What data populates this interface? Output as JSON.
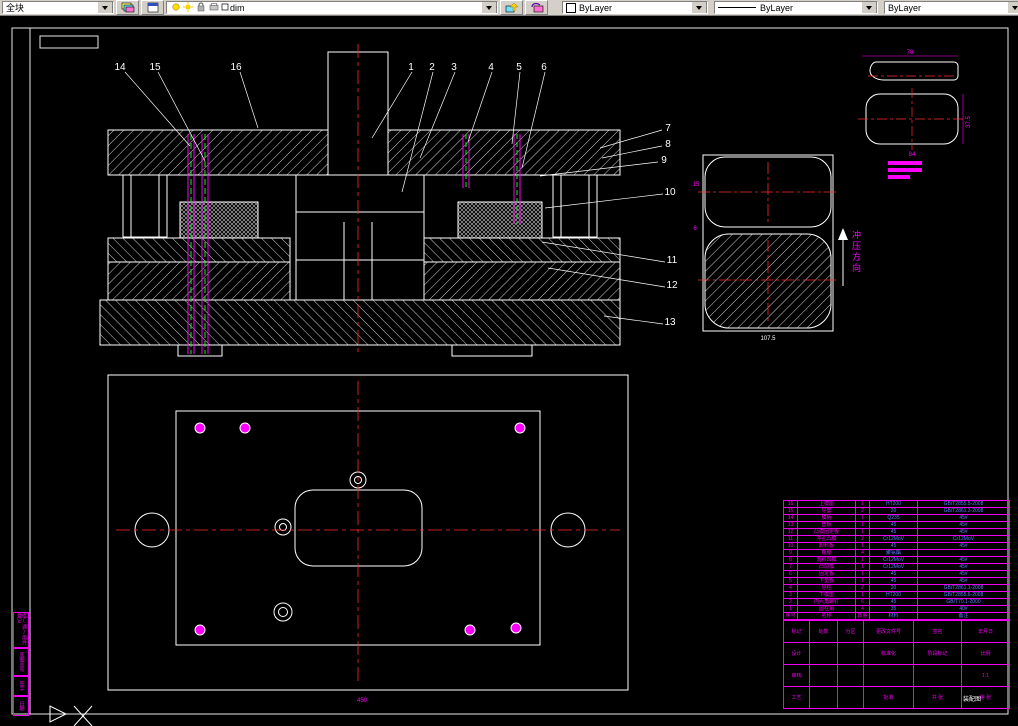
{
  "toolbar": {
    "style_combo": "全块",
    "layer_combo": "dim",
    "color_combo": "ByLayer",
    "linetype_combo": "ByLayer",
    "lineweight_combo": "ByLayer"
  },
  "callouts": [
    "1",
    "2",
    "3",
    "4",
    "5",
    "6",
    "7",
    "8",
    "9",
    "10",
    "11",
    "12",
    "13",
    "14",
    "15",
    "16"
  ],
  "labels": {
    "stamp_direction": "冲压方向",
    "detail_dim": "107.5",
    "detail_dim_a": "15",
    "detail_dim_b": "6",
    "strip_dim": "78",
    "part_dim_h": "37.5",
    "part_dim_w": "84",
    "plan_dim": "450"
  },
  "frame": {
    "left_labels": [
      "借(通)用件登记",
      "底图总号",
      "签字",
      "日期"
    ]
  },
  "title_block": {
    "bom_header": [
      "序号",
      "名称",
      "数量",
      "材料",
      "备注"
    ],
    "bom": [
      [
        "16",
        "上模座",
        "1",
        "HT200",
        "GB/T2855.5-2008"
      ],
      [
        "15",
        "导套",
        "2",
        "20",
        "GB/T2861.3-2008"
      ],
      [
        "14",
        "模柄",
        "1",
        "Q235",
        "45#"
      ],
      [
        "13",
        "垫板",
        "1",
        "45",
        "45#"
      ],
      [
        "12",
        "凸模固定板",
        "1",
        "45",
        "45#"
      ],
      [
        "11",
        "冲孔凸模",
        "2",
        "Cr12MoV",
        "Cr12MoV"
      ],
      [
        "10",
        "卸料板",
        "1",
        "45",
        "45#"
      ],
      [
        "9",
        "橡胶",
        "4",
        "聚氨酯",
        ""
      ],
      [
        "8",
        "落料凹模",
        "1",
        "Cr12MoV",
        "45#"
      ],
      [
        "7",
        "凸凹模",
        "1",
        "Cr12MoV",
        "45#"
      ],
      [
        "6",
        "固定板",
        "1",
        "45",
        "45#"
      ],
      [
        "5",
        "下垫板",
        "1",
        "45",
        "45#"
      ],
      [
        "4",
        "导柱",
        "2",
        "20",
        "GB/T2861.1-2008"
      ],
      [
        "3",
        "下模座",
        "1",
        "HT200",
        "GB/T2855.6-2008"
      ],
      [
        "2",
        "内六角螺钉",
        "6",
        "45",
        "GB/T70.1-2000"
      ],
      [
        "1",
        "圆柱销",
        "4",
        "35",
        "40#"
      ]
    ],
    "fields_rows": [
      [
        "标记",
        "处数",
        "分区",
        "更改文件号",
        "签名",
        "年月日"
      ],
      [
        "设计",
        "",
        "",
        "标准化",
        "阶段标记",
        "比例"
      ],
      [
        "审核",
        "",
        "",
        "",
        "",
        "1:1"
      ],
      [
        "工艺",
        "",
        "",
        "批准",
        "共 张",
        "第 张"
      ]
    ],
    "title": "装配图"
  }
}
